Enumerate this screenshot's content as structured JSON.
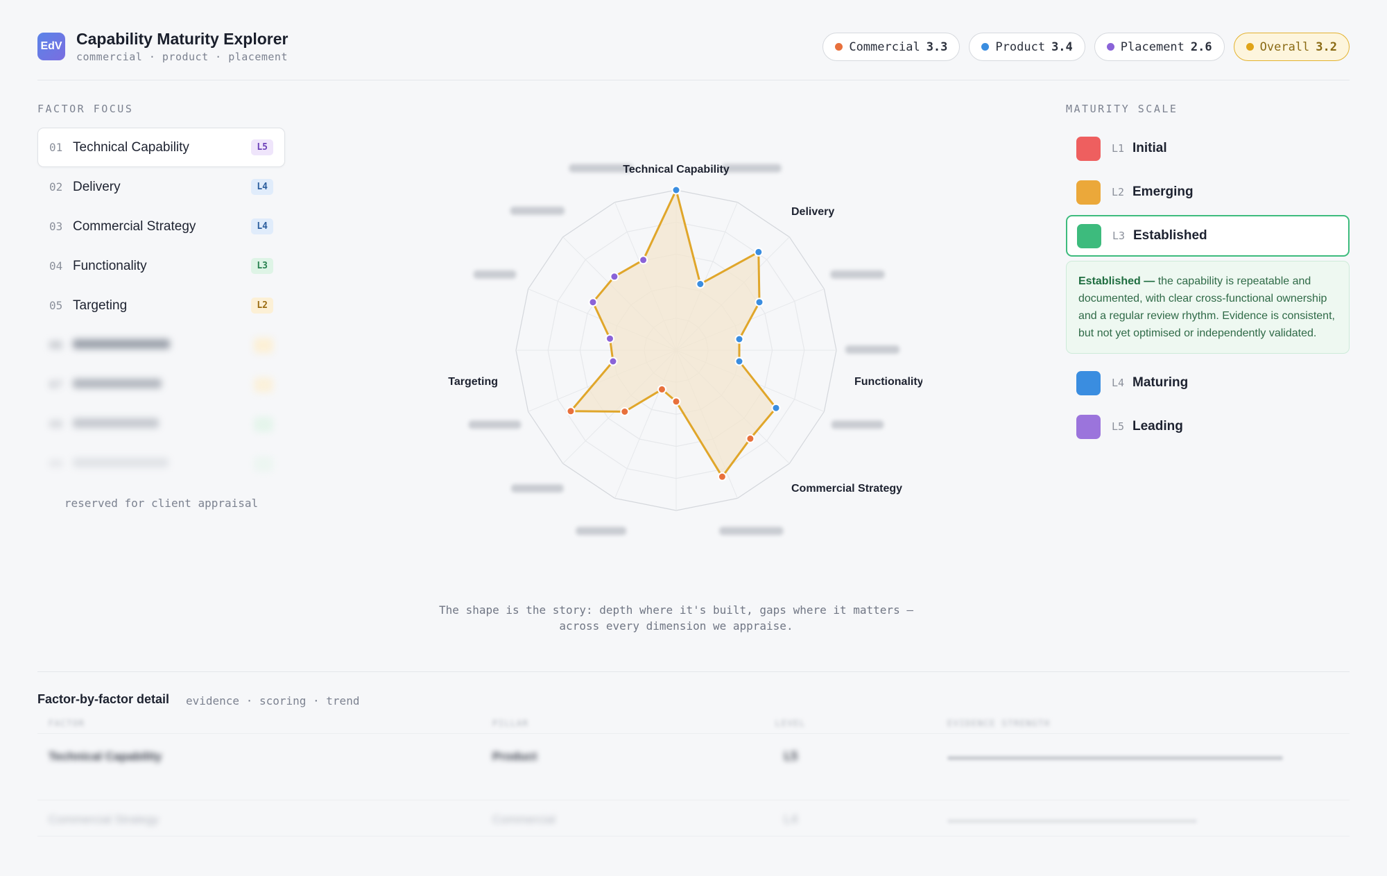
{
  "header": {
    "logo": "EdV",
    "title": "Capability Maturity Explorer",
    "subtitle": "commercial · product · placement",
    "scores": [
      {
        "label": "Commercial",
        "value": "3.3",
        "color": "#e8703c"
      },
      {
        "label": "Product",
        "value": "3.4",
        "color": "#3a8de0"
      },
      {
        "label": "Placement",
        "value": "2.6",
        "color": "#8a63d8"
      },
      {
        "label": "Overall",
        "value": "3.2",
        "color": "#e0a418"
      }
    ]
  },
  "factor_focus": {
    "title": "FACTOR FOCUS",
    "items": [
      {
        "num": "01",
        "name": "Technical Capability",
        "level": "L5"
      },
      {
        "num": "02",
        "name": "Delivery",
        "level": "L4"
      },
      {
        "num": "03",
        "name": "Commercial Strategy",
        "level": "L4"
      },
      {
        "num": "04",
        "name": "Functionality",
        "level": "L3"
      },
      {
        "num": "05",
        "name": "Targeting",
        "level": "L2"
      },
      {
        "num": "06",
        "name": "",
        "level": ""
      },
      {
        "num": "07",
        "name": "",
        "level": ""
      },
      {
        "num": "08",
        "name": "",
        "level": ""
      },
      {
        "num": "09",
        "name": "",
        "level": ""
      }
    ],
    "reserved_note": "reserved for client appraisal"
  },
  "radar": {
    "labels": [
      "Technical Capability",
      "Delivery",
      "Functionality",
      "Commercial Strategy",
      "Targeting"
    ],
    "max_level": 5,
    "spokes": 16,
    "points": [
      {
        "value": 5.0,
        "pillar": "Product"
      },
      {
        "value": 2.2,
        "pillar": "Product"
      },
      {
        "value": 4.0,
        "pillar": "Product"
      },
      {
        "value": 3.0,
        "pillar": "Product"
      },
      {
        "value": 2.0,
        "pillar": "Product"
      },
      {
        "value": 2.0,
        "pillar": "Product"
      },
      {
        "value": 3.6,
        "pillar": "Product"
      },
      {
        "value": 3.6,
        "pillar": "Commercial"
      },
      {
        "value": 4.2,
        "pillar": "Commercial"
      },
      {
        "value": 1.6,
        "pillar": "Commercial"
      },
      {
        "value": 1.3,
        "pillar": "Commercial"
      },
      {
        "value": 2.5,
        "pillar": "Commercial"
      },
      {
        "value": 3.8,
        "pillar": "Commercial"
      },
      {
        "value": 2.0,
        "pillar": "Placement"
      },
      {
        "value": 2.1,
        "pillar": "Placement"
      },
      {
        "value": 3.0,
        "pillar": "Placement"
      },
      {
        "value": 3.0,
        "pillar": "Placement"
      },
      {
        "value": 3.0,
        "pillar": "Placement"
      }
    ],
    "fill_color": "#f3e6cd",
    "line_color": "#e0a62a"
  },
  "tagline": "The shape is the story: depth where it's built, gaps where it matters — across every dimension we appraise.",
  "maturity_scale": {
    "title": "MATURITY SCALE",
    "levels": [
      {
        "code": "L1",
        "name": "Initial",
        "color": "#ee5f5f"
      },
      {
        "code": "L2",
        "name": "Emerging",
        "color": "#eba83a"
      },
      {
        "code": "L3",
        "name": "Established",
        "color": "#3dbb7d"
      },
      {
        "code": "L4",
        "name": "Maturing",
        "color": "#3a8de0"
      },
      {
        "code": "L5",
        "name": "Leading",
        "color": "#9b74dc"
      }
    ],
    "selected_desc_title": "Established —",
    "selected_desc_text": "the capability is repeatable and documented, with clear cross-functional ownership and a regular review rhythm. Evidence is consistent, but not yet optimised or independently validated."
  },
  "detail": {
    "title": "Factor-by-factor detail",
    "subtitle": "evidence · scoring · trend",
    "columns": [
      "FACTOR",
      "PILLAR",
      "LEVEL",
      "EVIDENCE STRENGTH"
    ],
    "rows": [
      [
        "Technical Capability",
        "Product",
        "L5"
      ],
      [
        "Commercial Strategy",
        "Commercial",
        "L4"
      ]
    ]
  }
}
